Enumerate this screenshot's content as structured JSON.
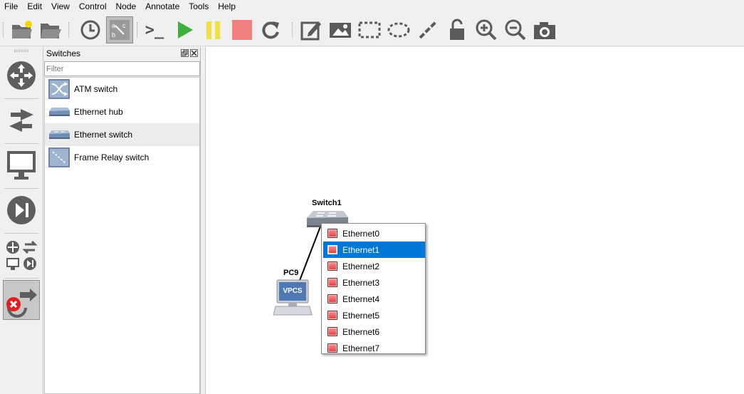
{
  "menu": [
    "File",
    "Edit",
    "View",
    "Control",
    "Node",
    "Annotate",
    "Tools",
    "Help"
  ],
  "toolbar": {
    "buttons": [
      "new-project",
      "open-project",
      "snapshot",
      "show-interface-labels",
      "console-all",
      "start-all",
      "suspend-all",
      "stop-all",
      "reload-all",
      "add-note",
      "insert-picture",
      "draw-rectangle",
      "draw-ellipse",
      "draw-line",
      "lock-unlock",
      "zoom-in",
      "zoom-out",
      "screenshot"
    ],
    "console_glyph": ">_"
  },
  "dock": {
    "title": "Switches",
    "filter_placeholder": "Filter",
    "items": [
      {
        "label": "ATM switch"
      },
      {
        "label": "Ethernet hub"
      },
      {
        "label": "Ethernet switch"
      },
      {
        "label": "Frame Relay switch"
      }
    ],
    "selected_index": 2
  },
  "canvas": {
    "switch_label": "Switch1",
    "pc_label": "PC9",
    "pc_screen_text": "VPCS"
  },
  "context_menu": {
    "items": [
      "Ethernet0",
      "Ethernet1",
      "Ethernet2",
      "Ethernet3",
      "Ethernet4",
      "Ethernet5",
      "Ethernet6",
      "Ethernet7"
    ],
    "highlighted_index": 1
  },
  "colors": {
    "highlight": "#0078d7",
    "port_icon": "#e03a3a",
    "start_green": "#3fb03f",
    "suspend_yellow": "#f0e040",
    "stop_red": "#f08080"
  }
}
